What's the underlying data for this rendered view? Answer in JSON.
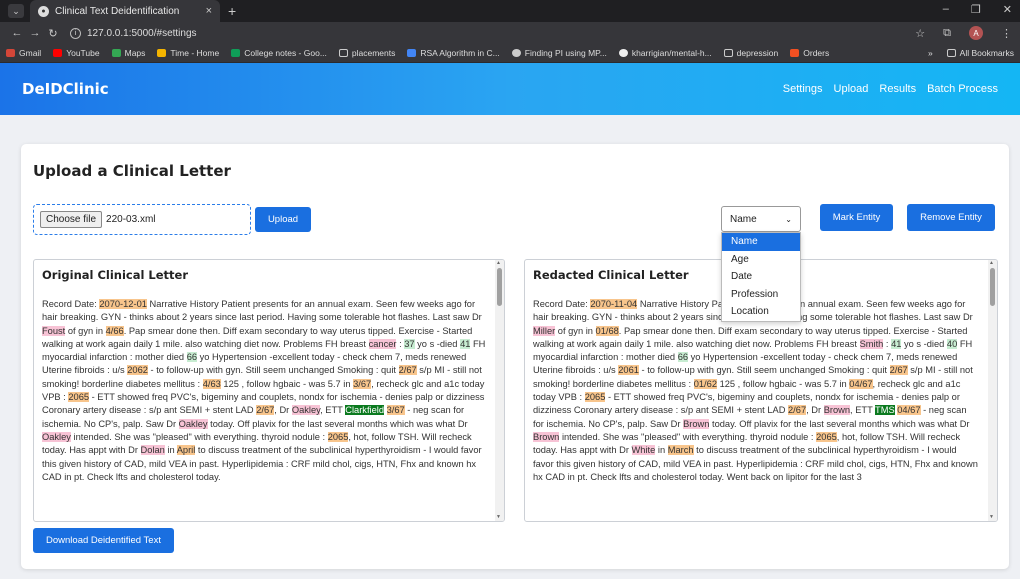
{
  "browser": {
    "tab_title": "Clinical Text Deidentification",
    "tab_close": "×",
    "new_tab": "+",
    "url": "127.0.0.1:5000/#settings",
    "bookmarks": [
      "Gmail",
      "YouTube",
      "Maps",
      "Time - Home",
      "College notes - Goo...",
      "placements",
      "RSA Algorithm in C...",
      "Finding PI using MP...",
      "kharrigian/mental-h...",
      "depression",
      "Orders"
    ],
    "more": "»",
    "all_bookmarks": "All Bookmarks",
    "avatar": "A"
  },
  "app": {
    "brand": "DeIDClinic",
    "nav": [
      "Settings",
      "Upload",
      "Results",
      "Batch Process"
    ]
  },
  "page": {
    "title": "Upload a Clinical Letter",
    "choose_file": "Choose file",
    "file_name": "220-03.xml",
    "upload": "Upload",
    "select_value": "Name",
    "options": [
      "Name",
      "Age",
      "Date",
      "Profession",
      "Location"
    ],
    "mark_entity": "Mark Entity",
    "remove_entity": "Remove Entity",
    "download": "Download Deidentified Text"
  },
  "original": {
    "title": "Original Clinical Letter",
    "segments": [
      [
        "t",
        "Record Date: "
      ],
      [
        "date",
        "2070-12-01"
      ],
      [
        "t",
        " Narrative History Patient presents for an annual exam. Seen few weeks ago for hair breaking. GYN - thinks about 2 years since last period. Having some tolerable hot flashes. Last saw Dr "
      ],
      [
        "name",
        "Foust"
      ],
      [
        "t",
        " of gyn in "
      ],
      [
        "date",
        "4/66"
      ],
      [
        "t",
        ". Pap smear done then. Diff exam secondary to way uterus tipped. Exercise - Started walking at work again daily 1 mile. also watching diet now. Problems FH breast "
      ],
      [
        "name",
        "cancer"
      ],
      [
        "t",
        " : "
      ],
      [
        "age",
        "37"
      ],
      [
        "t",
        " yo s -died "
      ],
      [
        "age",
        "41"
      ],
      [
        "t",
        " FH myocardial infarction : mother died "
      ],
      [
        "age",
        "66"
      ],
      [
        "t",
        " yo Hypertension -excellent today - check chem 7, meds renewed Uterine fibroids : u/s "
      ],
      [
        "date",
        "2062"
      ],
      [
        "t",
        " - to follow-up with gyn. Still seem unchanged Smoking : quit "
      ],
      [
        "date",
        "2/67"
      ],
      [
        "t",
        " s/p MI - still not smoking! borderline diabetes mellitus : "
      ],
      [
        "date",
        "4/63"
      ],
      [
        "t",
        " 125 , follow hgbaic - was 5.7 in "
      ],
      [
        "date",
        "3/67"
      ],
      [
        "t",
        ", recheck glc and a1c today VPB : "
      ],
      [
        "date",
        "2065"
      ],
      [
        "t",
        " - ETT showed freq PVC's, bigeminy and couplets, nondx for ischemia - denies palp or dizziness Coronary artery disease : s/p ant SEMI + stent LAD "
      ],
      [
        "date",
        "2/67"
      ],
      [
        "t",
        ", Dr "
      ],
      [
        "name",
        "Oakley"
      ],
      [
        "t",
        ", ETT "
      ],
      [
        "prof",
        "Clarkfield"
      ],
      [
        "t",
        " "
      ],
      [
        "date",
        "3/67"
      ],
      [
        "t",
        " - neg scan for ischemia. No CP's, palp. Saw Dr "
      ],
      [
        "name",
        "Oakley"
      ],
      [
        "t",
        " today. Off plavix for the last several months which was what Dr "
      ],
      [
        "name",
        "Oakley"
      ],
      [
        "t",
        " intended. She was \"pleased\" with everything. thyroid nodule : "
      ],
      [
        "date",
        "2065"
      ],
      [
        "t",
        ", hot, follow TSH. Will recheck today. Has appt with Dr "
      ],
      [
        "name",
        "Dolan"
      ],
      [
        "t",
        " in "
      ],
      [
        "date",
        "April"
      ],
      [
        "t",
        " to discuss treatment of the subclinical hyperthyroidism - I would favor this given history of CAD, mild VEA in past. Hyperlipidemia : CRF mild chol, cigs, HTN, Fhx and known hx CAD in pt. Check lfts and cholesterol today."
      ]
    ]
  },
  "redacted": {
    "title": "Redacted Clinical Letter",
    "segments": [
      [
        "t",
        "Record Date: "
      ],
      [
        "date",
        "2070-11-04"
      ],
      [
        "t",
        " Narrative History Patient presents for an annual exam. Seen few weeks ago for hair breaking. GYN - thinks about 2 years since last period. Having some tolerable hot flashes. Last saw Dr "
      ],
      [
        "name",
        "Miller"
      ],
      [
        "t",
        " of gyn in "
      ],
      [
        "date",
        "01/68"
      ],
      [
        "t",
        ". Pap smear done then. Diff exam secondary to way uterus tipped. Exercise - Started walking at work again daily 1 mile. also watching diet now. Problems FH breast "
      ],
      [
        "name",
        "Smith"
      ],
      [
        "t",
        " : "
      ],
      [
        "age",
        "41"
      ],
      [
        "t",
        " yo s -died "
      ],
      [
        "age",
        "40"
      ],
      [
        "t",
        " FH myocardial infarction : mother died "
      ],
      [
        "age",
        "66"
      ],
      [
        "t",
        " yo Hypertension -excellent today - check chem 7, meds renewed Uterine fibroids : u/s "
      ],
      [
        "date",
        "2061"
      ],
      [
        "t",
        " - to follow-up with gyn. Still seem unchanged Smoking : quit "
      ],
      [
        "date",
        "2/67"
      ],
      [
        "t",
        " s/p MI - still not smoking! borderline diabetes mellitus : "
      ],
      [
        "date",
        "01/62"
      ],
      [
        "t",
        " 125 , follow hgbaic - was 5.7 in "
      ],
      [
        "date",
        "04/67"
      ],
      [
        "t",
        ", recheck glc and a1c today VPB : "
      ],
      [
        "date",
        "2065"
      ],
      [
        "t",
        " - ETT showed freq PVC's, bigeminy and couplets, nondx for ischemia - denies palp or dizziness Coronary artery disease : s/p ant SEMI + stent LAD "
      ],
      [
        "date",
        "2/67"
      ],
      [
        "t",
        ", Dr "
      ],
      [
        "name",
        "Brown"
      ],
      [
        "t",
        ", ETT "
      ],
      [
        "prof",
        "TMS"
      ],
      [
        "t",
        " "
      ],
      [
        "date",
        "04/67"
      ],
      [
        "t",
        " - neg scan for ischemia. No CP's, palp. Saw Dr "
      ],
      [
        "name",
        "Brown"
      ],
      [
        "t",
        " today. Off plavix for the last several months which was what Dr "
      ],
      [
        "name",
        "Brown"
      ],
      [
        "t",
        " intended. She was \"pleased\" with everything. thyroid nodule : "
      ],
      [
        "date",
        "2065"
      ],
      [
        "t",
        ", hot, follow TSH. Will recheck today. Has appt with Dr "
      ],
      [
        "name",
        "White"
      ],
      [
        "t",
        " in "
      ],
      [
        "date",
        "March"
      ],
      [
        "t",
        " to discuss treatment of the subclinical hyperthyroidism - I would favor this given history of CAD, mild VEA in past. Hyperlipidemia : CRF mild chol, cigs, HTN, Fhx and known hx CAD in pt. Check lfts and cholesterol today. Went back on lipitor for the last 3"
      ]
    ]
  },
  "colors": {
    "name": "#f7c3d5",
    "date": "#f8c58c",
    "age": "#c7ecd1",
    "profession": "#0b7a1f",
    "accent": "#1a6fe0"
  }
}
